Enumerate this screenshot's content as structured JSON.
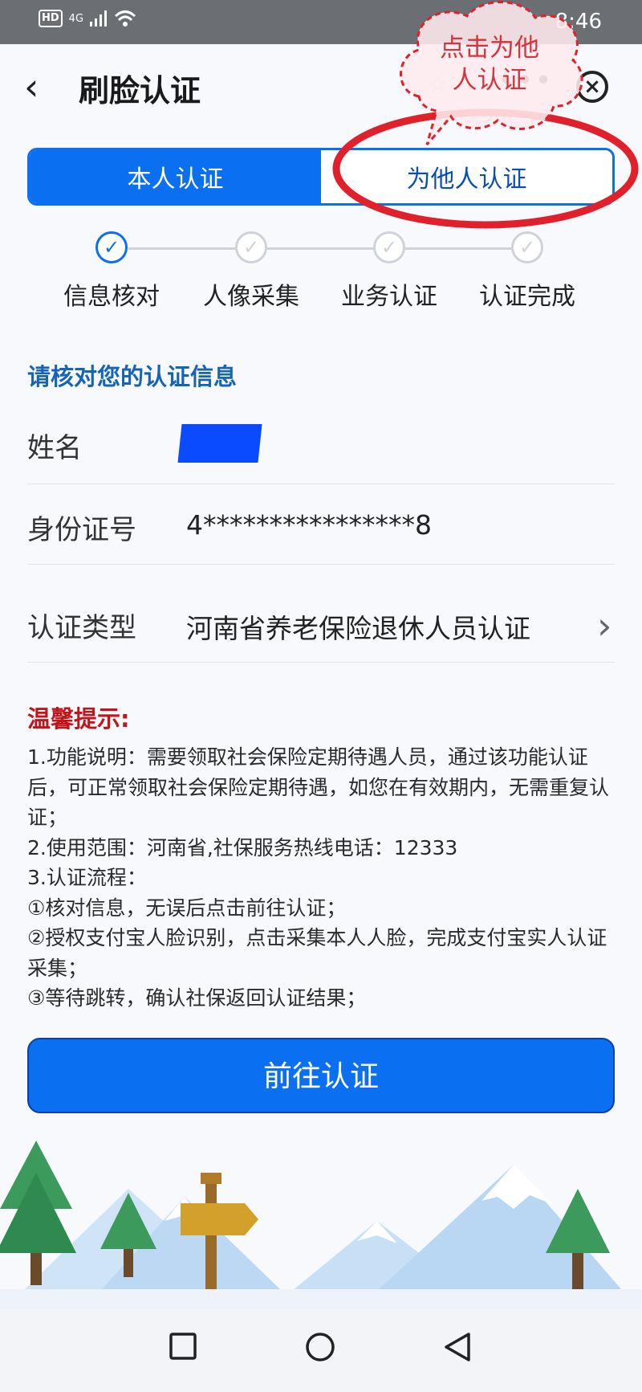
{
  "status_bar": {
    "hd": "HD",
    "network": "4G",
    "time": "8:46"
  },
  "header": {
    "back_icon": "‹",
    "title": "刷脸认证",
    "close_icon": "×",
    "fav_icon": "☆",
    "more_icon": "•••"
  },
  "tabs": {
    "self": "本人认证",
    "others": "为他人认证"
  },
  "steps": [
    {
      "label": "信息核对",
      "done": true
    },
    {
      "label": "人像采集",
      "done": false
    },
    {
      "label": "业务认证",
      "done": false
    },
    {
      "label": "认证完成",
      "done": false
    }
  ],
  "check_mark": "✓",
  "info": {
    "heading": "请核对您的认证信息",
    "name_label": "姓名",
    "id_label": "身份证号",
    "id_value": "4****************8",
    "type_label": "认证类型",
    "type_value": "河南省养老保险退休人员认证",
    "chevron": "›"
  },
  "tips": {
    "title": "温馨提示:",
    "lines": [
      "1.功能说明：需要领取社会保险定期待遇人员，通过该功能认证后，可正常领取社会保险定期待遇，如您在有效期内，无需重复认证；",
      "2.使用范围：河南省,社保服务热线电话：12333",
      "3.认证流程：",
      "①核对信息，无误后点击前往认证；",
      "②授权支付宝人脸识别，点击采集本人人脸，完成支付宝实人认证采集；",
      "③等待跳转，确认社保返回认证结果；"
    ]
  },
  "action_button": "前往认证",
  "annotation": {
    "line1": "点击为他",
    "line2": "人认证"
  },
  "colors": {
    "primary": "#0a6ff0",
    "tip_red": "#c0161b",
    "annotation_red": "#e0202b",
    "heading_blue": "#1664b5"
  },
  "icons": [
    "back-icon",
    "star-icon",
    "more-icon",
    "close-icon",
    "check-icon",
    "chevron-right-icon",
    "square-nav-icon",
    "circle-nav-icon",
    "triangle-back-nav-icon",
    "signpost-icon"
  ]
}
